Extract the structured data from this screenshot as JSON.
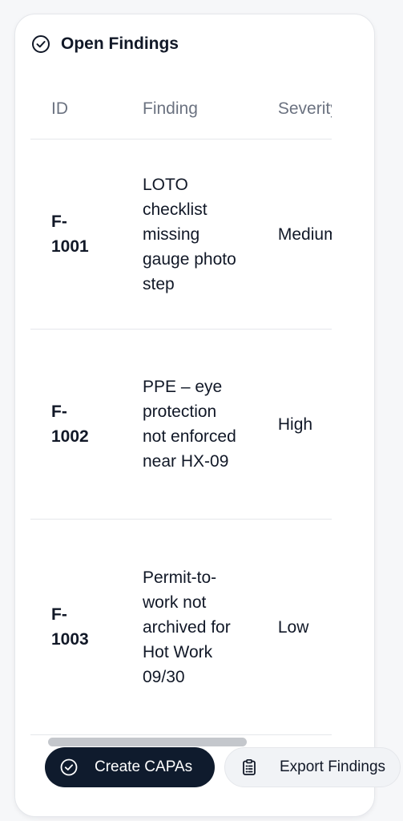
{
  "panel": {
    "title": "Open Findings",
    "title_icon": "check-circle-icon"
  },
  "table": {
    "columns": [
      "ID",
      "Finding",
      "Severity"
    ],
    "rows": [
      {
        "id": "F-1001",
        "finding": "LOTO checklist missing gauge photo step",
        "severity": "Medium"
      },
      {
        "id": "F-1002",
        "finding": "PPE – eye protection not enforced near HX-09",
        "severity": "High"
      },
      {
        "id": "F-1003",
        "finding": "Permit-to-work not archived for Hot Work 09/30",
        "severity": "Low"
      }
    ]
  },
  "actions": {
    "create_label": "Create CAPAs",
    "create_icon": "check-circle-icon",
    "export_label": "Export Findings",
    "export_icon": "clipboard-icon"
  },
  "colors": {
    "primary_button": "#0f1b2d",
    "secondary_button": "#f1f3f6",
    "border": "#e5e7eb",
    "muted_text": "#6b7280"
  }
}
